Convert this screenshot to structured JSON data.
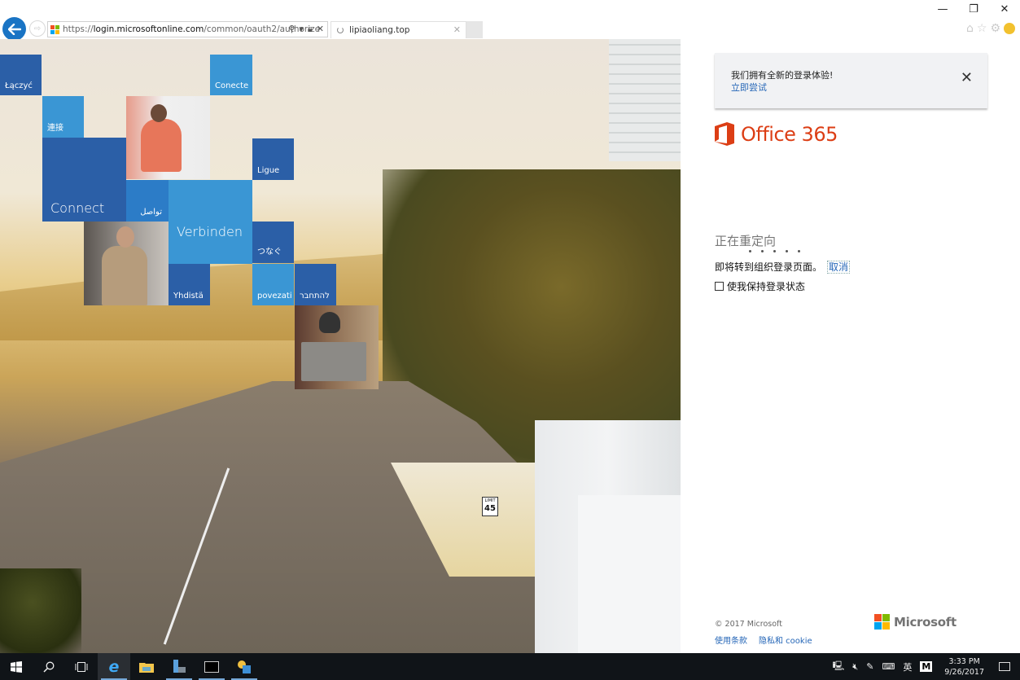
{
  "browser": {
    "url_scheme": "https://",
    "url_host": "login.microsoftonline.com",
    "url_path": "/common/oauth2/authorize",
    "tab_title": "lipiaoliang.top",
    "icons": {
      "back": "arrow-left-icon",
      "forward": "forward-icon",
      "search": "search-icon",
      "dropdown": "chevron-down-icon",
      "lock": "lock-icon",
      "stop": "close-icon",
      "home": "home-icon",
      "favorites": "star-icon",
      "settings": "gear-icon",
      "feedback": "smiley-icon"
    },
    "window_controls": {
      "minimize": "—",
      "restore": "❐",
      "close": "✕"
    }
  },
  "tiles": [
    {
      "label": "Łączyć"
    },
    {
      "label": "連接"
    },
    {
      "label": "Connect"
    },
    {
      "label": "Conecte"
    },
    {
      "label": "Ligue"
    },
    {
      "label": "تواصل"
    },
    {
      "label": "Verbinden"
    },
    {
      "label": "つなぐ"
    },
    {
      "label": "Yhdistä"
    },
    {
      "label": "povezati"
    },
    {
      "label": "להתחבר"
    }
  ],
  "background_sign": {
    "speed_limit_label": "LIMIT",
    "speed_limit_value": "45"
  },
  "panel": {
    "banner": {
      "message": "我们拥有全新的登录体验!",
      "link": "立即尝试",
      "close": "✕"
    },
    "product_name": "Office 365",
    "redirect_title": "正在重定向",
    "redirect_message": "即将转到组织登录页面。",
    "cancel_link": "取消",
    "keep_signed_in": "使我保持登录状态",
    "keep_signed_in_checked": false,
    "copyright": "© 2017 Microsoft",
    "footer_links": [
      "使用条款",
      "隐私和 cookie"
    ],
    "brand": "Microsoft",
    "brand_colors": [
      "#f25022",
      "#7fba00",
      "#00a4ef",
      "#ffb900"
    ],
    "office_color": "#dc3e15",
    "link_color": "#2566b7"
  },
  "taskbar": {
    "items": [
      {
        "name": "start",
        "icon": "windows-icon"
      },
      {
        "name": "search",
        "icon": "search-icon"
      },
      {
        "name": "task-view",
        "icon": "task-view-icon"
      },
      {
        "name": "internet-explorer",
        "icon": "ie-icon"
      },
      {
        "name": "file-explorer",
        "icon": "folder-icon"
      },
      {
        "name": "server-manager",
        "icon": "server-manager-icon"
      },
      {
        "name": "command-prompt",
        "icon": "terminal-icon"
      },
      {
        "name": "network-app",
        "icon": "network-app-icon"
      }
    ],
    "tray": {
      "network_icon": "network-icon",
      "volume_icon": "volume-muted-icon",
      "pen_icon": "pen-icon",
      "keyboard_icon": "keyboard-icon",
      "ime_label": "英",
      "ime_mode": "M",
      "time": "3:33 PM",
      "date": "9/26/2017",
      "notifications_icon": "notification-icon"
    }
  }
}
